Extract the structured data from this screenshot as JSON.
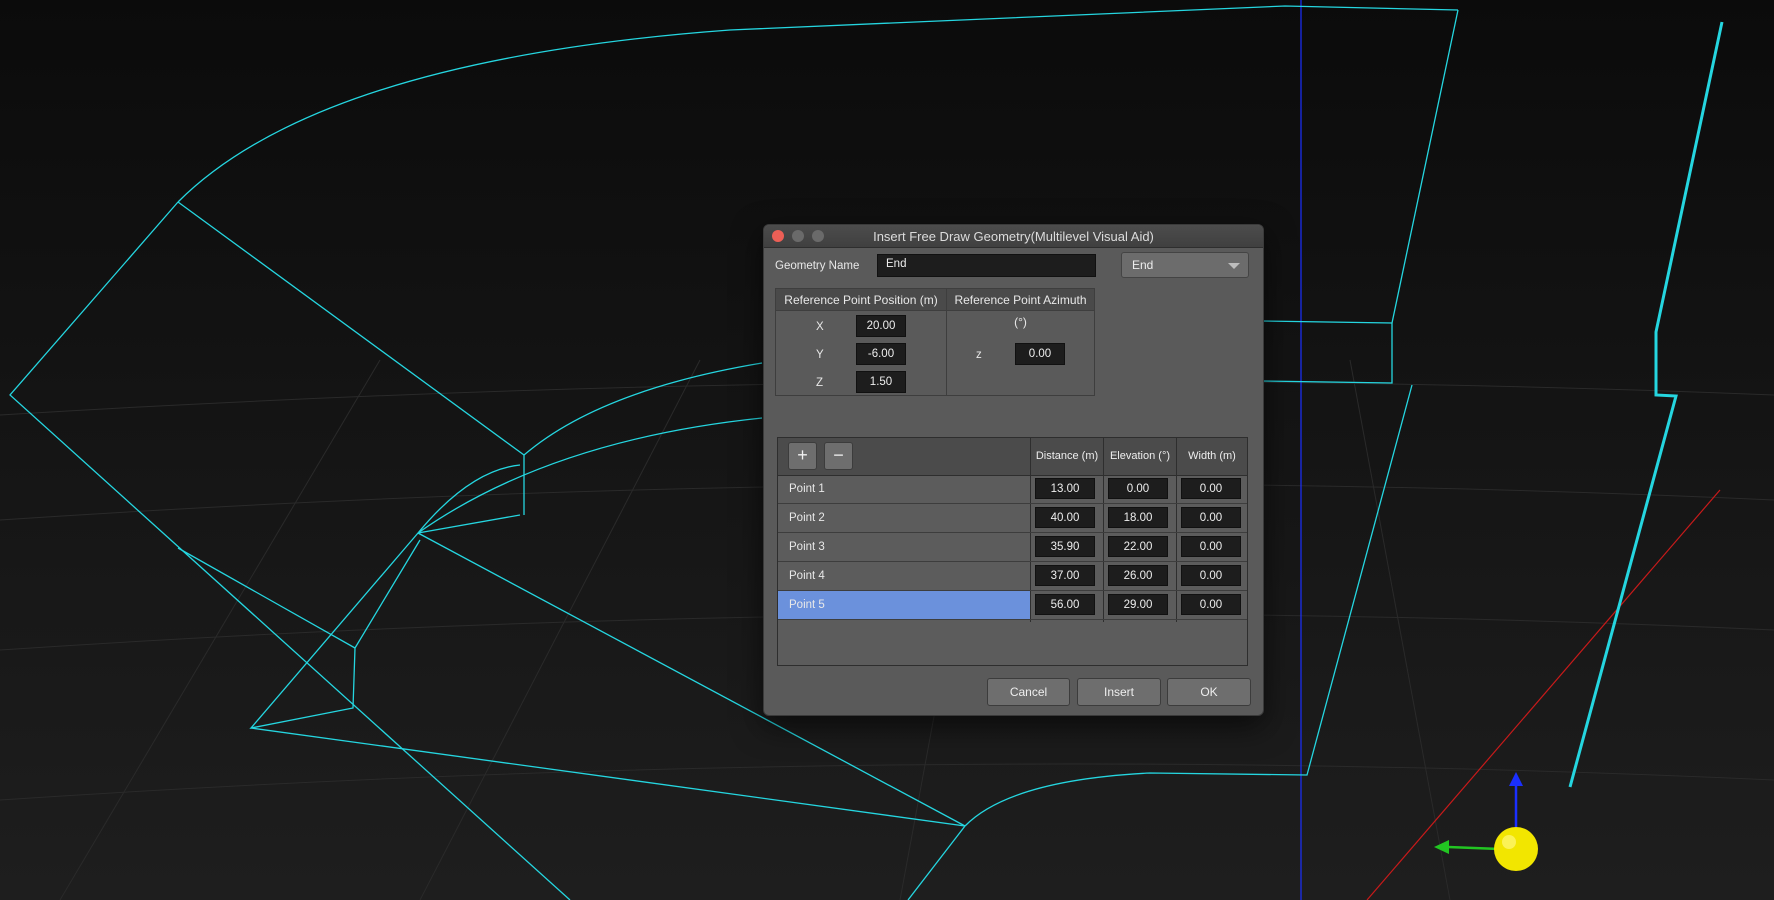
{
  "dialog": {
    "title": "Insert Free Draw Geometry(Multilevel Visual Aid)",
    "geometry_name_label": "Geometry Name",
    "geometry_name_value": "End",
    "geometry_type_select": "End",
    "ref_position_header": "Reference Point Position (m)",
    "ref_azimuth_header": "Reference Point Azimuth (°)",
    "ref": {
      "x_label": "X",
      "x_value": "20.00",
      "y_label": "Y",
      "y_value": "-6.00",
      "z_label": "Z",
      "z_value": "1.50",
      "az_label": "z",
      "az_value": "0.00"
    },
    "points": {
      "add_label": "+",
      "remove_label": "−",
      "headers": [
        "Distance (m)",
        "Elevation (°)",
        "Width (m)"
      ],
      "rows": [
        {
          "name": "Point 1",
          "distance": "13.00",
          "elevation": "0.00",
          "width": "0.00"
        },
        {
          "name": "Point 2",
          "distance": "40.00",
          "elevation": "18.00",
          "width": "0.00"
        },
        {
          "name": "Point 3",
          "distance": "35.90",
          "elevation": "22.00",
          "width": "0.00"
        },
        {
          "name": "Point 4",
          "distance": "37.00",
          "elevation": "26.00",
          "width": "0.00"
        },
        {
          "name": "Point 5",
          "distance": "56.00",
          "elevation": "29.00",
          "width": "0.00"
        }
      ],
      "selected_row": "Point 5"
    },
    "buttons": {
      "cancel": "Cancel",
      "insert": "Insert",
      "ok": "OK"
    }
  },
  "colors": {
    "wireframe": "#25d6e0",
    "selection": "#6b91dc",
    "axis_y": "#22c522",
    "axis_z": "#1a2fff",
    "axis_x": "#c81a1a",
    "pivot": "#f2e600"
  }
}
